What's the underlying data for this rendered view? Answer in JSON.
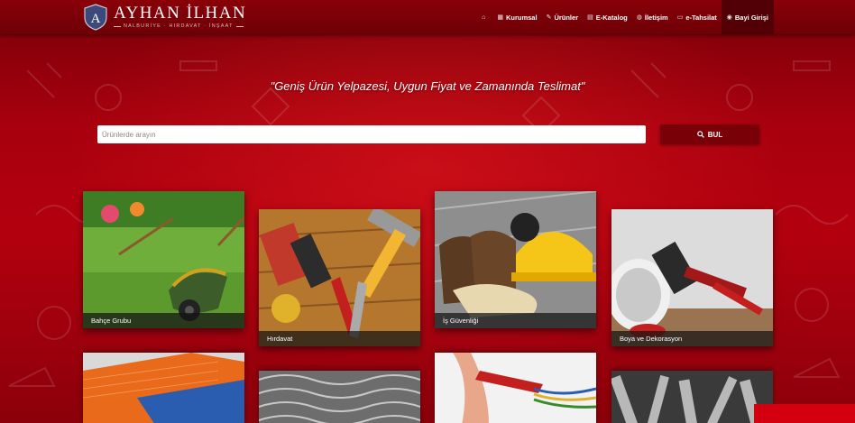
{
  "brand": {
    "title": "AYHAN İLHAN",
    "subtitle": "NALBURİYE · HIRDAVAT · İNŞAAT",
    "shield_letter": "A"
  },
  "nav": {
    "items": [
      {
        "icon": "home-icon",
        "glyph": "⌂",
        "label": ""
      },
      {
        "icon": "building-icon",
        "glyph": "▦",
        "label": "Kurumsal"
      },
      {
        "icon": "wrench-icon",
        "glyph": "✎",
        "label": "Ürünler"
      },
      {
        "icon": "book-icon",
        "glyph": "▤",
        "label": "E-Katalog"
      },
      {
        "icon": "globe-icon",
        "glyph": "◍",
        "label": "İletişim"
      },
      {
        "icon": "card-icon",
        "glyph": "▭",
        "label": "e-Tahsilat"
      },
      {
        "icon": "user-icon",
        "glyph": "◉",
        "label": "Bayi Girişi"
      }
    ]
  },
  "hero": {
    "slogan": "\"Geniş Ürün Yelpazesi, Uygun Fiyat ve Zamanında Teslimat\""
  },
  "search": {
    "placeholder": "Ürünlerde arayın",
    "button_label": "BUL"
  },
  "categories": [
    {
      "label": "Bahçe Grubu"
    },
    {
      "label": "Hırdavat"
    },
    {
      "label": "İş Güvenliği"
    },
    {
      "label": "Boya ve Dekorasyon"
    }
  ],
  "colors": {
    "primary": "#b3000f",
    "navbar": "#7a0008",
    "active_nav": "#520005"
  }
}
